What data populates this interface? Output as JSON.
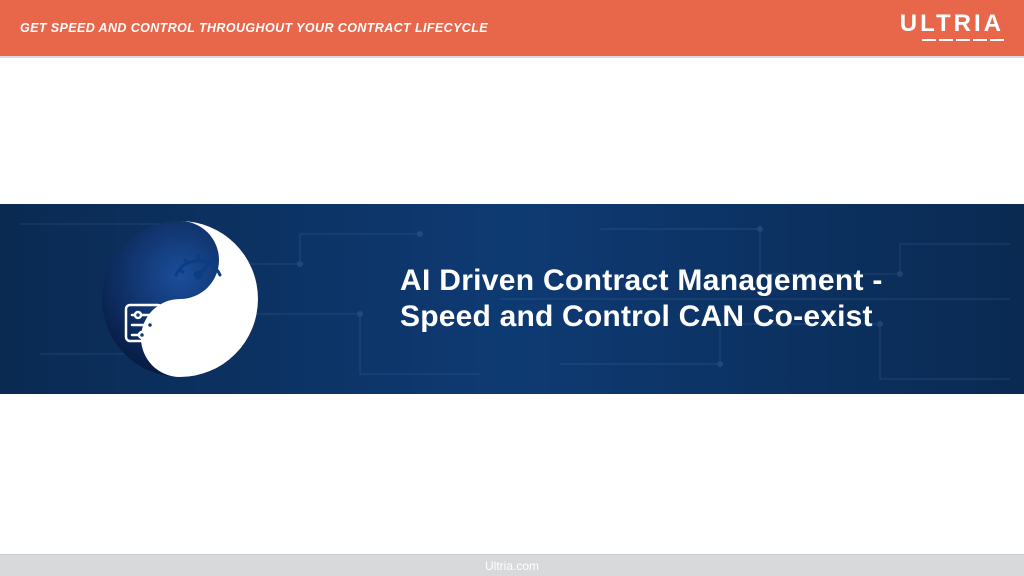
{
  "header": {
    "tagline": "GET SPEED AND CONTROL THROUGHOUT YOUR CONTRACT LIFECYCLE",
    "logo_text": "ULTRIA"
  },
  "hero": {
    "line1": "AI Driven Contract Management -",
    "line2": "Speed and Control CAN Co-exist"
  },
  "footer": {
    "text": "Ultria.com"
  },
  "colors": {
    "accent": "#e8664a",
    "hero_bg_dark": "#0a2a52",
    "hero_bg_light": "#0e3a73",
    "footer_bg": "#d7d9db"
  }
}
